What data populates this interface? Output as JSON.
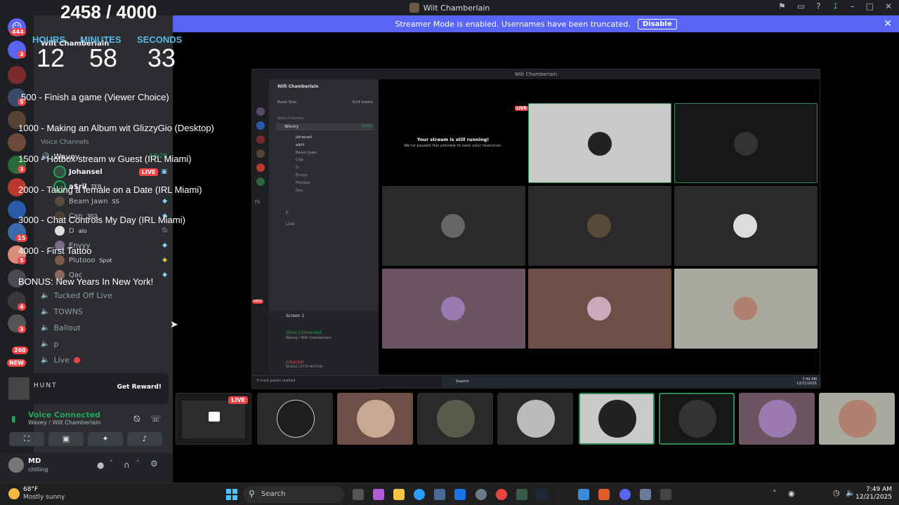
{
  "window": {
    "title": "Wilt Chamberlain"
  },
  "streamer_bar": {
    "message": "Streamer Mode is enabled. Usernames have been truncated.",
    "disable_label": "Disable"
  },
  "overlay": {
    "counter": "2458 / 4000",
    "timer": {
      "hours_label": "HOURS",
      "minutes_label": "MINUTES",
      "seconds_label": "SECONDS",
      "hours": "12",
      "minutes": "58",
      "seconds": "33"
    },
    "goals": [
      "500 - Finish a game (Viewer Choice)",
      "1000 - Making an Album wit GlizzyGio (Desktop)",
      "1500 - Hotbox stream w Guest (IRL Miami)",
      "2000 - Taking a female on a Date (IRL Miami)",
      "3000 - Chat Controls My Day (IRL Miami)",
      "4000 - First Tattoo",
      "BONUS: New Years In New York!"
    ]
  },
  "guilds": {
    "badges": [
      "444",
      "3",
      "5",
      "3",
      "15",
      "5",
      "4",
      "3",
      "260"
    ],
    "new_label": "NEW"
  },
  "sidebar": {
    "server_name": "Wilt Chamberlain",
    "voice_section": "Voice Channels",
    "active_channel": {
      "name": "Wavey",
      "timer": "13:29"
    },
    "users": [
      {
        "name": "Johansel",
        "badge": "LIVE",
        "tag": ""
      },
      {
        "name": "a$ril",
        "badge": "",
        "tag": "TFB"
      },
      {
        "name": "Beam Jawn",
        "badge": "",
        "tag": "SS"
      },
      {
        "name": "Cap",
        "badge": "",
        "tag": "302"
      },
      {
        "name": "D",
        "badge": "",
        "tag": "alo"
      },
      {
        "name": "Envyy",
        "badge": "",
        "tag": ""
      },
      {
        "name": "Plutooo",
        "badge": "",
        "tag": "Spot"
      },
      {
        "name": "Qac",
        "badge": "",
        "tag": ""
      }
    ],
    "channels": [
      "Tucked Off Live",
      "TOWNS",
      "Ballout",
      "p",
      "Live"
    ]
  },
  "promo": {
    "game": "HUNT",
    "reward_label": "Get Reward!"
  },
  "voice": {
    "status": "Voice Connected",
    "location": "Wavey / Wilt Chamberlain"
  },
  "user": {
    "name": "MD",
    "status": "chilling"
  },
  "stream": {
    "live_label": "LIVE",
    "inner": {
      "title": "Wilt Chamberlain",
      "server": "Wilt Chamberlain",
      "boost": "Boost Goal",
      "boost_count": "6/14 boosts",
      "voice_section": "Voice Channels",
      "channel": "Wavey",
      "channel_timer": "13:29",
      "users": [
        "Johansel",
        "a$ril",
        "Beam Jawn",
        "Cap",
        "D",
        "Envyy",
        "Plutooo",
        "Qac"
      ],
      "extra_channels": [
        "p",
        "Live"
      ],
      "paused_title": "Your stream is still running!",
      "paused_sub": "We've paused this preview to save your resources.",
      "screen_share": "Screen 1",
      "voice_status": "Voice Connected",
      "voice_loc": "Wavey / Wilt Chamberlain",
      "user_name": "Johansel",
      "user_status": "WHOLE LOTTA MOTION",
      "mods": "3 mod packs loaded",
      "inner_taskbar_time": "7:49 AM",
      "inner_taskbar_date": "12/21/2025",
      "search": "Search",
      "new_label": "NEW",
      "f5_label": "F5"
    }
  },
  "taskbar": {
    "weather_temp": "68°F",
    "weather_desc": "Mostly sunny",
    "search": "Search",
    "time": "7:49 AM",
    "date": "12/21/2025"
  },
  "colors": {
    "accent": "#5865f2",
    "live": "#ed4245",
    "online": "#23a55a",
    "timer_label": "#5bb8e8"
  }
}
